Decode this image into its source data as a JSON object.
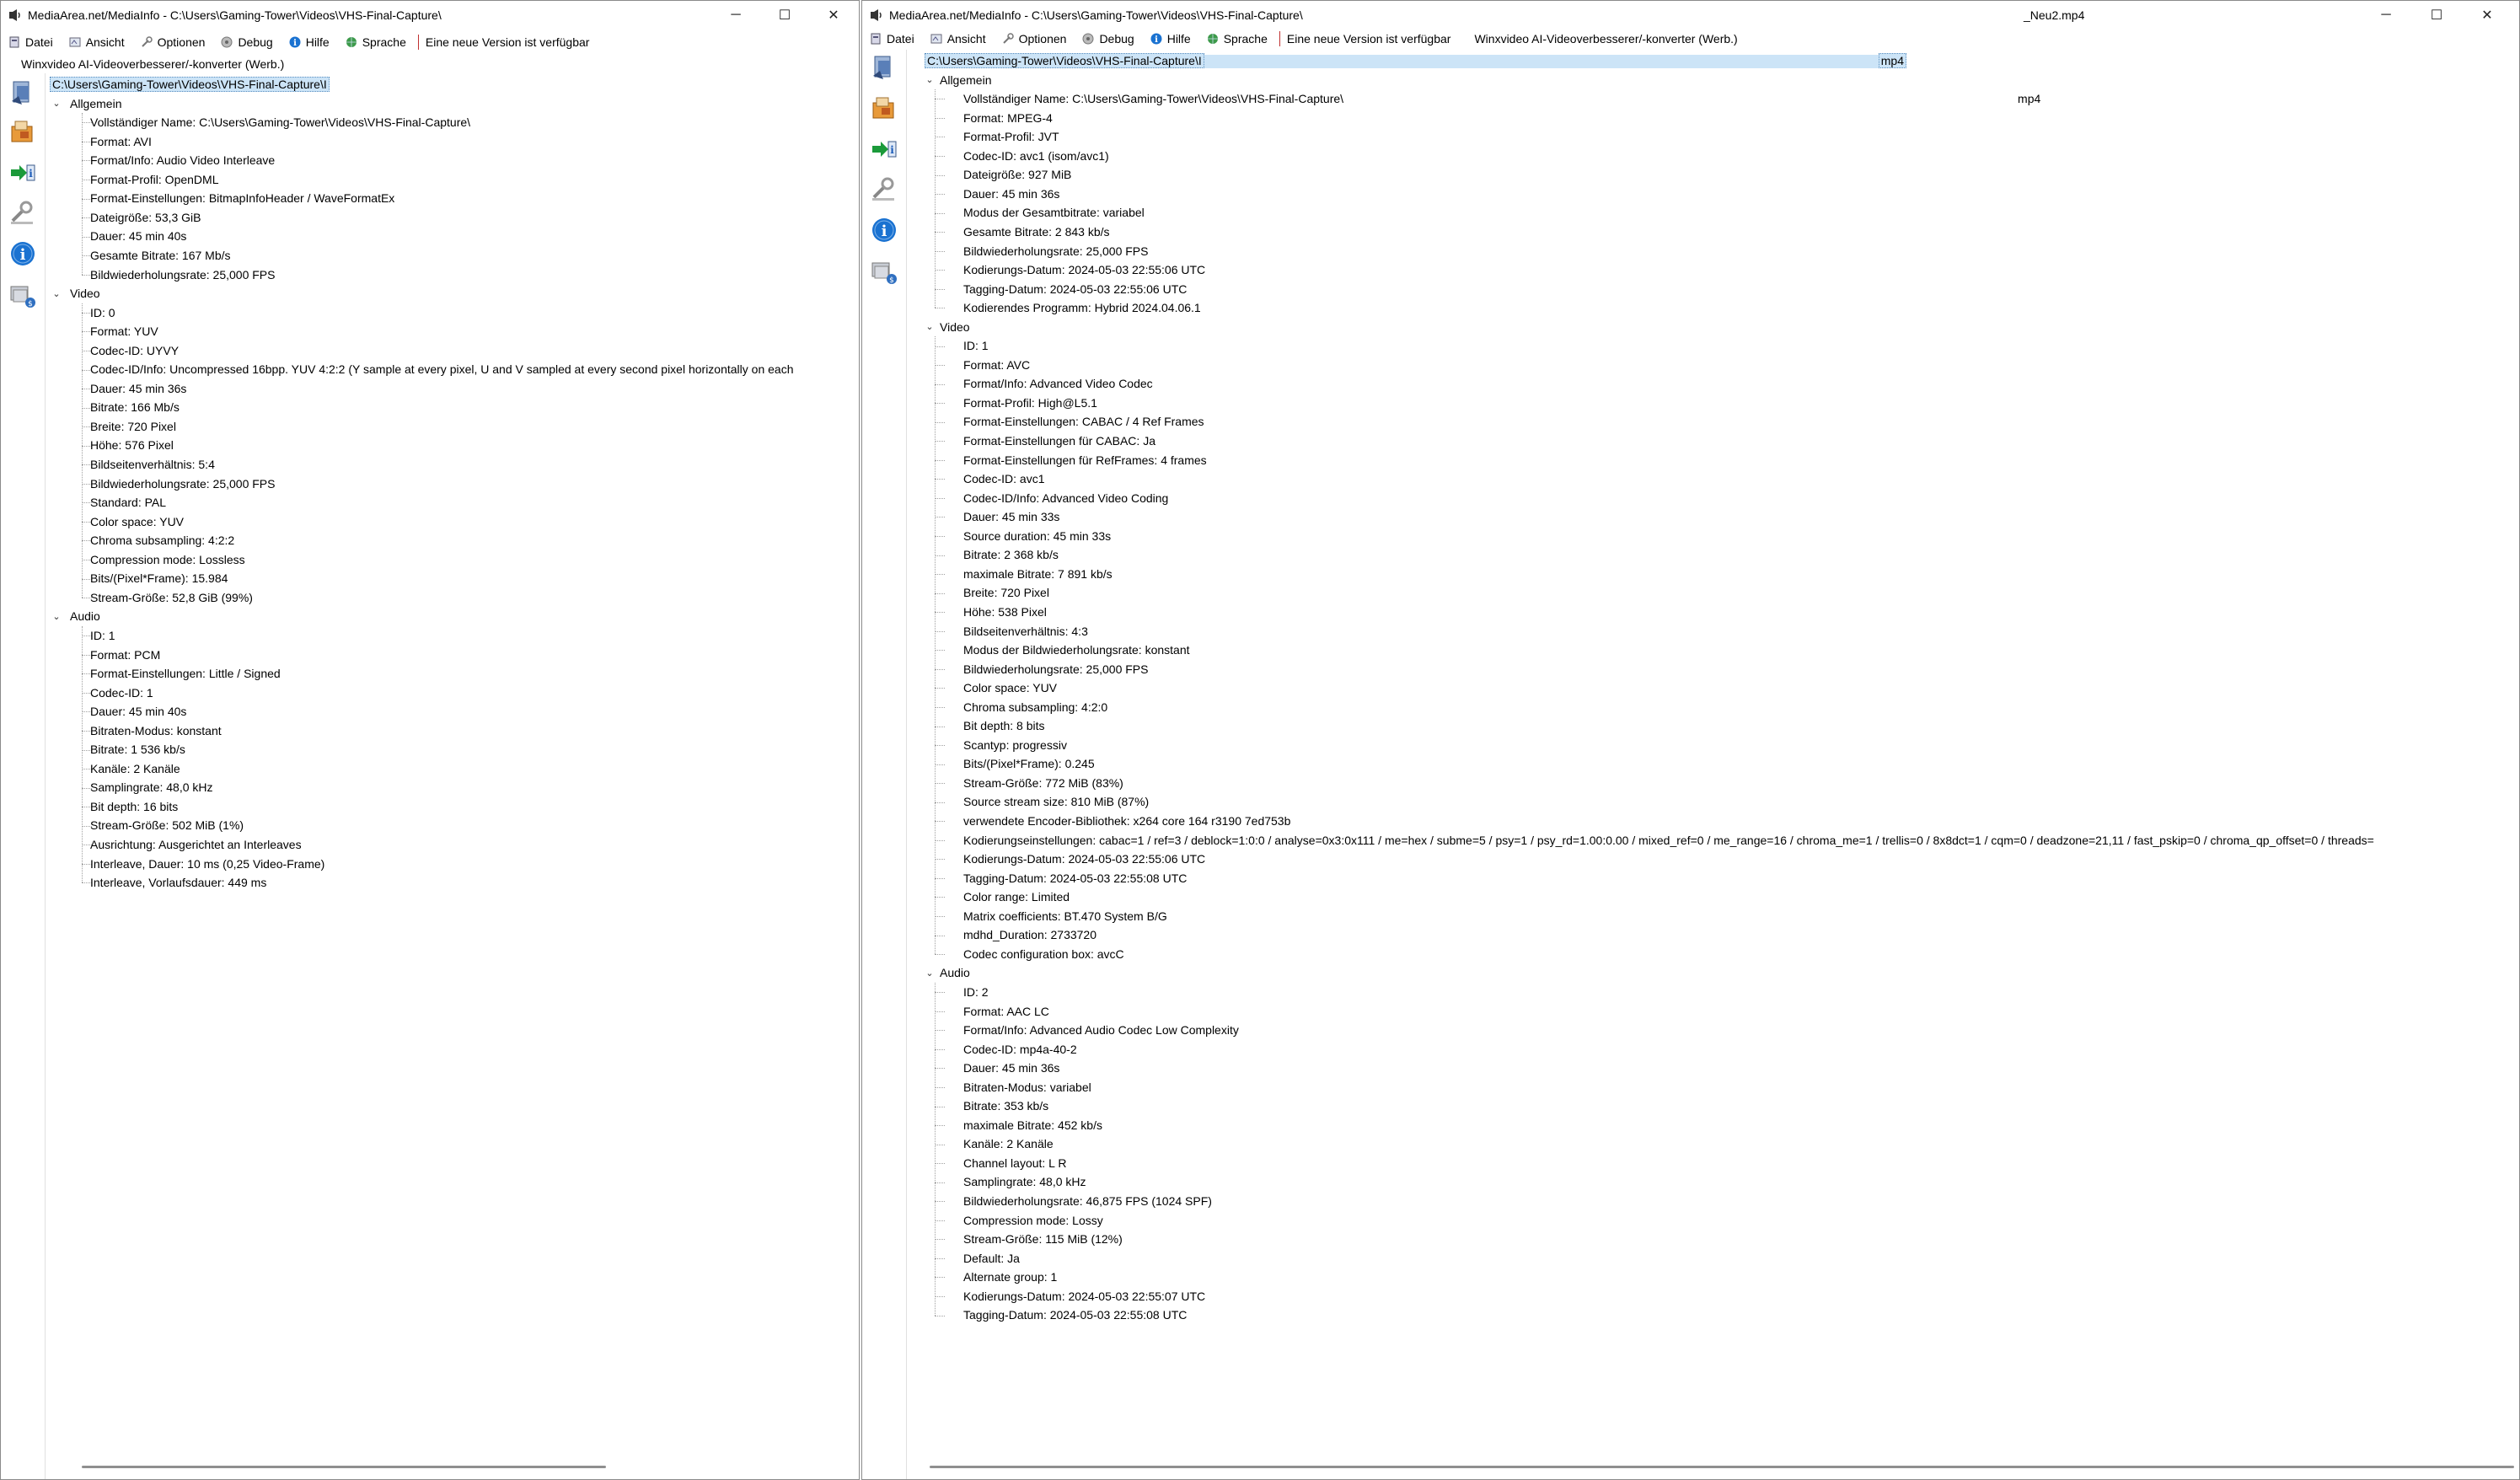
{
  "left": {
    "title": "MediaArea.net/MediaInfo - C:\\Users\\Gaming-Tower\\Videos\\VHS-Final-Capture\\",
    "menu": [
      {
        "label": "Datei",
        "icon": "datei-icon"
      },
      {
        "label": "Ansicht",
        "icon": "ansicht-icon"
      },
      {
        "label": "Optionen",
        "icon": "optionen-icon"
      },
      {
        "label": "Debug",
        "icon": "debug-icon"
      },
      {
        "label": "Hilfe",
        "icon": "hilfe-icon"
      },
      {
        "label": "Sprache",
        "icon": "sprache-icon"
      }
    ],
    "new_version": "Eine neue Version ist verfügbar",
    "ad_text": "Winxvideo AI-Videoverbesserer/-konverter (Werb.)",
    "root": "C:\\Users\\Gaming-Tower\\Videos\\VHS-Final-Capture\\I",
    "sections": [
      {
        "name": "Allgemein",
        "items": [
          "Vollständiger Name: C:\\Users\\Gaming-Tower\\Videos\\VHS-Final-Capture\\",
          "Format: AVI",
          "Format/Info: Audio Video Interleave",
          "Format-Profil: OpenDML",
          "Format-Einstellungen: BitmapInfoHeader / WaveFormatEx",
          "Dateigröße: 53,3 GiB",
          "Dauer: 45 min 40s",
          "Gesamte Bitrate: 167 Mb/s",
          "Bildwiederholungsrate: 25,000 FPS"
        ]
      },
      {
        "name": "Video",
        "items": [
          "ID: 0",
          "Format: YUV",
          "Codec-ID: UYVY",
          "Codec-ID/Info: Uncompressed 16bpp. YUV 4:2:2 (Y sample at every pixel, U and V sampled at every second pixel horizontally on each",
          "Dauer: 45 min 36s",
          "Bitrate: 166 Mb/s",
          "Breite: 720 Pixel",
          "Höhe: 576 Pixel",
          "Bildseitenverhältnis: 5:4",
          "Bildwiederholungsrate: 25,000 FPS",
          "Standard: PAL",
          "Color space: YUV",
          "Chroma subsampling: 4:2:2",
          "Compression mode: Lossless",
          "Bits/(Pixel*Frame): 15.984",
          "Stream-Größe: 52,8 GiB (99%)"
        ]
      },
      {
        "name": "Audio",
        "items": [
          "ID: 1",
          "Format: PCM",
          "Format-Einstellungen: Little / Signed",
          "Codec-ID: 1",
          "Dauer: 45 min 40s",
          "Bitraten-Modus: konstant",
          "Bitrate: 1 536 kb/s",
          "Kanäle: 2 Kanäle",
          "Samplingrate: 48,0 kHz",
          "Bit depth: 16 bits",
          "Stream-Größe: 502 MiB (1%)",
          "Ausrichtung: Ausgerichtet an Interleaves",
          "Interleave, Dauer: 10  ms (0,25 Video-Frame)",
          "Interleave, Vorlaufsdauer: 449  ms"
        ]
      }
    ]
  },
  "right": {
    "title": "MediaArea.net/MediaInfo - C:\\Users\\Gaming-Tower\\Videos\\VHS-Final-Capture\\",
    "title_end": "_Neu2.mp4",
    "menu": [
      {
        "label": "Datei",
        "icon": "datei-icon"
      },
      {
        "label": "Ansicht",
        "icon": "ansicht-icon"
      },
      {
        "label": "Optionen",
        "icon": "optionen-icon"
      },
      {
        "label": "Debug",
        "icon": "debug-icon"
      },
      {
        "label": "Hilfe",
        "icon": "hilfe-icon"
      },
      {
        "label": "Sprache",
        "icon": "sprache-icon"
      }
    ],
    "new_version": "Eine neue Version ist verfügbar",
    "ad_text": "Winxvideo AI-Videoverbesserer/-konverter (Werb.)",
    "root": "C:\\Users\\Gaming-Tower\\Videos\\VHS-Final-Capture\\I",
    "root_end": "mp4",
    "name_end": "mp4",
    "sections": [
      {
        "name": "Allgemein",
        "items": [
          "Vollständiger Name: C:\\Users\\Gaming-Tower\\Videos\\VHS-Final-Capture\\",
          "Format: MPEG-4",
          "Format-Profil: JVT",
          "Codec-ID: avc1 (isom/avc1)",
          "Dateigröße: 927 MiB",
          "Dauer: 45 min 36s",
          "Modus der Gesamtbitrate: variabel",
          "Gesamte Bitrate: 2 843 kb/s",
          "Bildwiederholungsrate: 25,000 FPS",
          "Kodierungs-Datum: 2024-05-03 22:55:06 UTC",
          "Tagging-Datum: 2024-05-03 22:55:06 UTC",
          "Kodierendes Programm: Hybrid 2024.04.06.1"
        ]
      },
      {
        "name": "Video",
        "items": [
          "ID: 1",
          "Format: AVC",
          "Format/Info: Advanced Video Codec",
          "Format-Profil: High@L5.1",
          "Format-Einstellungen: CABAC / 4 Ref Frames",
          "Format-Einstellungen für CABAC: Ja",
          "Format-Einstellungen für RefFrames: 4 frames",
          "Codec-ID: avc1",
          "Codec-ID/Info: Advanced Video Coding",
          "Dauer: 45 min 33s",
          "Source duration: 45 min 33s",
          "Bitrate: 2 368 kb/s",
          "maximale Bitrate: 7 891 kb/s",
          "Breite: 720 Pixel",
          "Höhe: 538 Pixel",
          "Bildseitenverhältnis: 4:3",
          "Modus der Bildwiederholungsrate: konstant",
          "Bildwiederholungsrate: 25,000 FPS",
          "Color space: YUV",
          "Chroma subsampling: 4:2:0",
          "Bit depth: 8 bits",
          "Scantyp: progressiv",
          "Bits/(Pixel*Frame): 0.245",
          "Stream-Größe: 772 MiB (83%)",
          "Source stream size: 810 MiB (87%)",
          "verwendete Encoder-Bibliothek: x264 core 164 r3190 7ed753b",
          "Kodierungseinstellungen: cabac=1 / ref=3 / deblock=1:0:0 / analyse=0x3:0x111 / me=hex / subme=5 / psy=1 / psy_rd=1.00:0.00 / mixed_ref=0 / me_range=16 / chroma_me=1 / trellis=0 / 8x8dct=1 / cqm=0 / deadzone=21,11 / fast_pskip=0 / chroma_qp_offset=0 / threads=",
          "Kodierungs-Datum: 2024-05-03 22:55:06 UTC",
          "Tagging-Datum: 2024-05-03 22:55:08 UTC",
          "Color range: Limited",
          "Matrix coefficients: BT.470 System B/G",
          "mdhd_Duration: 2733720",
          "Codec configuration box: avcC"
        ]
      },
      {
        "name": "Audio",
        "items": [
          "ID: 2",
          "Format: AAC LC",
          "Format/Info: Advanced Audio Codec Low Complexity",
          "Codec-ID: mp4a-40-2",
          "Dauer: 45 min 36s",
          "Bitraten-Modus: variabel",
          "Bitrate: 353 kb/s",
          "maximale Bitrate: 452 kb/s",
          "Kanäle: 2 Kanäle",
          "Channel layout: L R",
          "Samplingrate: 48,0 kHz",
          "Bildwiederholungsrate: 46,875 FPS (1024 SPF)",
          "Compression mode: Lossy",
          "Stream-Größe: 115 MiB (12%)",
          "Default: Ja",
          "Alternate group: 1",
          "Kodierungs-Datum: 2024-05-03 22:55:07 UTC",
          "Tagging-Datum: 2024-05-03 22:55:08 UTC"
        ]
      }
    ]
  },
  "toolbar_icons": [
    "open-file-icon",
    "open-folder-icon",
    "export-icon",
    "preferences-icon",
    "about-icon",
    "donate-icon"
  ],
  "window_controls": {
    "minimize": "─",
    "maximize": "☐",
    "close": "✕"
  },
  "colors": {
    "selection": "#cce4f7",
    "tree_lines": "#a0a0a0",
    "accent": "#0a6fd8"
  }
}
